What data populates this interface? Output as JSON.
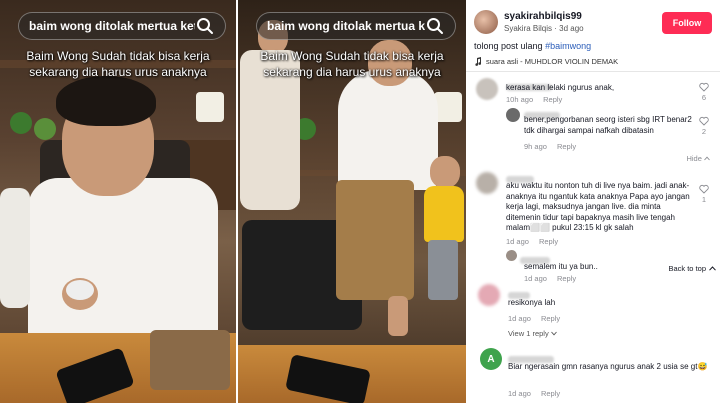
{
  "video_left": {
    "search_query": "baim wong ditolak mertua ketik...",
    "caption": "Baim Wong Sudah tidak bisa kerja sekarang dia harus urus anaknya"
  },
  "video_right": {
    "search_query": "baim wong ditolak mertua ketik...",
    "caption": "Baim Wong Sudah tidak bisa kerja sekarang dia harus urus anaknya"
  },
  "post": {
    "username": "syakirahbilqis99",
    "display_name": "Syakira Bilqis",
    "time": "3d ago",
    "follow_label": "Follow",
    "description_text": "tolong post ulang",
    "hashtag": "#baimwong",
    "sound": "suara asli - MUHDLOR VIOLIN DEMAK"
  },
  "comments": [
    {
      "text": "kerasa kan lelaki ngurus anak,",
      "time": "10h ago",
      "reply": "Reply",
      "likes": "6"
    },
    {
      "text": "bener,pengorbanan seorg isteri sbg IRT benar2 tdk dihargai sampai nafkah dibatasin",
      "time": "9h ago",
      "reply": "Reply",
      "likes": "2"
    },
    {
      "text": "aku waktu itu nonton tuh di live nya baim. jadi anak-anaknya itu ngantuk kata anaknya Papa ayo jangan kerja lagi, maksudnya jangan live. dia minta ditemenin tidur tapi bapaknya masih live tengah malam⬜⬜ pukul 23:15 kl gk salah",
      "time": "1d ago",
      "reply": "Reply",
      "likes": "1"
    },
    {
      "text": "semalem itu ya bun..",
      "time": "1d ago",
      "reply": "Reply"
    },
    {
      "text": "resikonya lah",
      "time": "1d ago",
      "reply": "Reply"
    },
    {
      "text": "Biar ngerasain gmn rasanya ngurus anak 2 usia se gt😅",
      "time": "1d ago",
      "reply": "Reply",
      "avatar_letter": "A"
    }
  ],
  "hide_label": "Hide",
  "view_reply_label": "View 1 reply",
  "back_to_top_label": "Back to top",
  "colors": {
    "follow": "#fe2c55",
    "hashtag": "#2b5db9",
    "meta": "#8a8b91",
    "avatar_a": "#3fa34d"
  },
  "icons": [
    "search-icon",
    "music-note-icon",
    "heart-icon",
    "chevron-up-icon",
    "chevron-down-icon"
  ]
}
